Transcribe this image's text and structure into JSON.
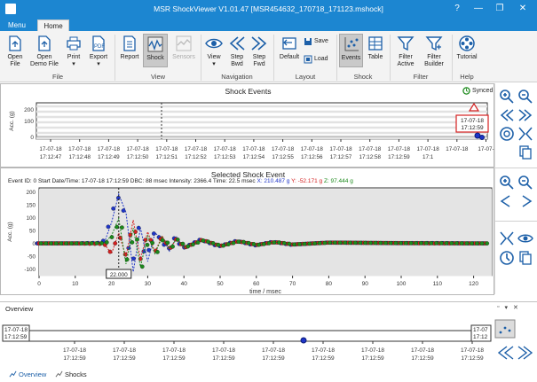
{
  "app": {
    "title": "MSR ShockViewer V1.01.47 [MSR454632_170718_171123.mshock]"
  },
  "window": {
    "help": "?",
    "minimize": "—",
    "restore": "❐",
    "close": "✕"
  },
  "tabs": {
    "menu": "Menu",
    "home": "Home"
  },
  "ribbon": {
    "file": {
      "group": "File",
      "open_file": [
        "Open",
        "File"
      ],
      "open_demo": [
        "Open",
        "Demo File"
      ],
      "print": [
        "Print",
        "▾"
      ],
      "export": [
        "Export",
        "▾"
      ]
    },
    "view": {
      "group": "View",
      "report": "Report",
      "shock": "Shock",
      "sensors": "Sensors"
    },
    "navigation": {
      "group": "Navigation",
      "view": [
        "View",
        "▾"
      ],
      "step_bwd": [
        "Step",
        "Bwd"
      ],
      "step_fwd": [
        "Step",
        "Fwd"
      ]
    },
    "layout": {
      "group": "Layout",
      "default": "Default",
      "save": "Save",
      "load": "Load"
    },
    "shock": {
      "group": "Shock",
      "events": "Events",
      "table": "Table"
    },
    "filter": {
      "group": "Filter",
      "filter_active": [
        "Filter",
        "Active"
      ],
      "filter_builder": [
        "Filter",
        "Builder"
      ]
    },
    "help": {
      "group": "Help",
      "tutorial": "Tutorial"
    }
  },
  "shock_events": {
    "title": "Shock Events",
    "synced": "Synced",
    "ylabel": "Acc. (g)",
    "yticks": [
      "200",
      "100",
      "0"
    ],
    "callout_date": "17-07-18",
    "callout_time": "17:12:59",
    "x_dates": [
      "17-07-18",
      "17-07-18",
      "17-07-18",
      "17-07-18",
      "17-07-18",
      "17-07-18",
      "17-07-18",
      "17-07-18",
      "17-07-18",
      "17-07-18",
      "17-07-18",
      "17-07-18",
      "17-07-18",
      "17-07-18",
      "17-07-18",
      "17-07-"
    ],
    "x_times": [
      "17:12:47",
      "17:12:48",
      "17:12:49",
      "17:12:50",
      "17:12:51",
      "17:12:52",
      "17:12:53",
      "17:12:54",
      "17:12:55",
      "17:12:56",
      "17:12:57",
      "17:12:58",
      "17:12:59",
      "17:1"
    ]
  },
  "selected": {
    "title": "Selected Shock Event",
    "info_prefix": "Event ID: 0   Start Date/Time: 17-07-18 17:12:59   DBC: 88 msec   Intensity: 2366.4   Time: 22.5 msec",
    "info_x": "X: 210.487 g",
    "info_y": "Y: -52.171 g",
    "info_z": "Z: 97.444 g",
    "ylabel": "Acc. (g)",
    "xlabel": "time / msec",
    "cursor": "22.000",
    "yticks": [
      "200",
      "150",
      "100",
      "50",
      "0",
      "-50",
      "-100"
    ],
    "xticks": [
      "0",
      "10",
      "20",
      "30",
      "40",
      "50",
      "60",
      "70",
      "80",
      "90",
      "100",
      "110",
      "120"
    ]
  },
  "overview": {
    "title": "Overview",
    "start_date": "17-07-18",
    "start_time": "17:12:59",
    "end_date": "17-07",
    "end_time": "17:12",
    "dates": [
      "17-07-18",
      "17-07-18",
      "17-07-18",
      "17-07-18",
      "17-07-18",
      "17-07-18",
      "17-07-18",
      "17-07-18",
      "17-07-18"
    ],
    "times": [
      "17:12:59",
      "17:12:59",
      "17:12:59",
      "17:12:59",
      "17:12:59",
      "17:12:59",
      "17:12:59",
      "17:12:59",
      "17:12:59"
    ],
    "tabs": [
      "Overview",
      "Shocks"
    ]
  },
  "colors": {
    "x": "#1f35c8",
    "y": "#d42020",
    "z": "#1c8a1c",
    "accent": "#1c86d1"
  },
  "chart_data": {
    "type": "line",
    "title": "Selected Shock Event",
    "xlabel": "time / msec",
    "ylabel": "Acc. (g)",
    "xlim": [
      0,
      125
    ],
    "ylim": [
      -125,
      215
    ],
    "series": [
      {
        "name": "X",
        "x": [
          0,
          10,
          18,
          20,
          22,
          24,
          26,
          28,
          30,
          32,
          34,
          36,
          38,
          40,
          45,
          50,
          55,
          60,
          65,
          70,
          80,
          90,
          100,
          110,
          120,
          124
        ],
        "values": [
          0,
          0,
          2,
          80,
          190,
          120,
          -110,
          60,
          -70,
          40,
          20,
          -30,
          25,
          -20,
          15,
          -12,
          10,
          -8,
          6,
          -5,
          3,
          2,
          1,
          1,
          0,
          0
        ]
      },
      {
        "name": "Y",
        "x": [
          0,
          10,
          18,
          20,
          22,
          24,
          26,
          28,
          30,
          32,
          34,
          36,
          38,
          40,
          45,
          50,
          55,
          60,
          65,
          70,
          80,
          90,
          100,
          110,
          120,
          124
        ],
        "values": [
          0,
          0,
          -2,
          -40,
          40,
          -52,
          90,
          -60,
          45,
          -35,
          30,
          -25,
          20,
          -18,
          14,
          -10,
          8,
          -6,
          5,
          -4,
          3,
          2,
          1,
          0,
          0,
          0
        ]
      },
      {
        "name": "Z",
        "x": [
          0,
          10,
          18,
          20,
          22,
          24,
          26,
          28,
          30,
          32,
          34,
          36,
          38,
          40,
          45,
          50,
          55,
          60,
          65,
          70,
          80,
          90,
          100,
          110,
          120,
          124
        ],
        "values": [
          0,
          0,
          1,
          30,
          97,
          -80,
          60,
          -90,
          30,
          -40,
          25,
          -20,
          18,
          -15,
          12,
          -10,
          8,
          -6,
          5,
          -4,
          3,
          2,
          1,
          1,
          0,
          0
        ]
      }
    ]
  }
}
